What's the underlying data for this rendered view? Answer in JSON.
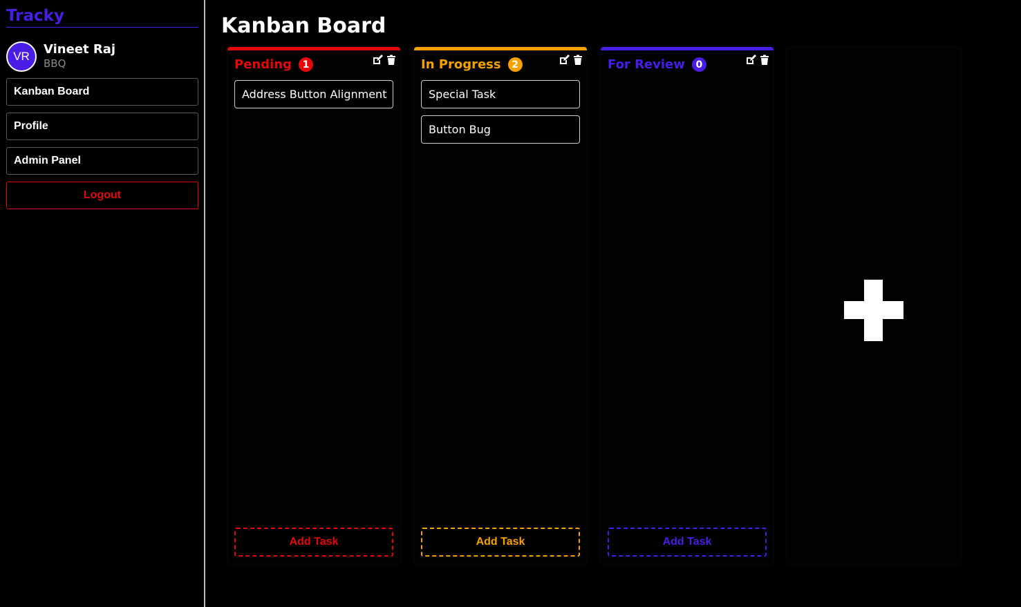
{
  "sidebar": {
    "brand": "Tracky",
    "user": {
      "initials": "VR",
      "name": "Vineet Raj",
      "org": "BBQ"
    },
    "nav": [
      {
        "label": "Kanban Board"
      },
      {
        "label": "Profile"
      },
      {
        "label": "Admin Panel"
      }
    ],
    "logout_label": "Logout"
  },
  "main": {
    "title": "Kanban Board",
    "columns": [
      {
        "title": "Pending",
        "count": "1",
        "color": "#e4080a",
        "tasks": [
          {
            "title": "Address Button Alignment"
          }
        ],
        "add_label": "Add Task"
      },
      {
        "title": "In Progress",
        "count": "2",
        "color": "#f5a201",
        "tasks": [
          {
            "title": "Special Task"
          },
          {
            "title": "Button Bug"
          }
        ],
        "add_label": "Add Task"
      },
      {
        "title": "For Review",
        "count": "0",
        "color": "#4a1de6",
        "tasks": [],
        "add_label": "Add Task"
      }
    ],
    "add_column_icon": "plus-icon"
  },
  "colors": {
    "background": "#000000",
    "accent": "#4a1de6",
    "danger": "#e4080a",
    "warning": "#f5a201"
  }
}
